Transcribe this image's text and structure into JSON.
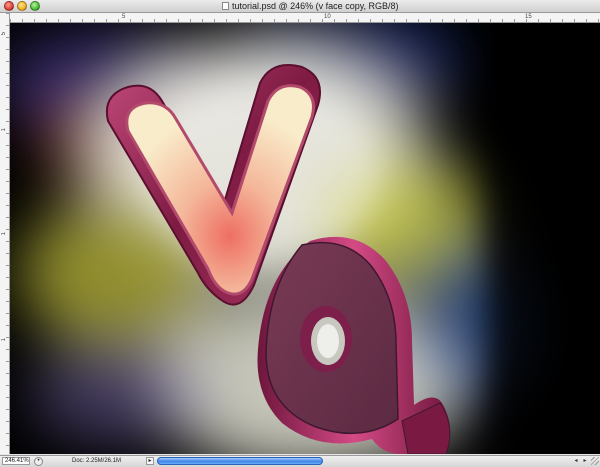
{
  "window": {
    "title": "tutorial.psd @ 246% (v face copy, RGB/8)"
  },
  "rulers": {
    "top_labels": [
      "5",
      "10",
      "15"
    ],
    "left_labels": [
      "5",
      "1",
      "1",
      "1"
    ]
  },
  "status_bar": {
    "zoom": "246.41%",
    "doc_info": "Doc: 2.25M/26.1M"
  },
  "icons": {
    "close": "close-button-icon",
    "minimize": "minimize-button-icon",
    "zoom": "zoom-button-icon",
    "document": "document-icon",
    "status_menu": "triangle-right-icon",
    "scroll_left": "arrow-left-icon",
    "scroll_right": "arrow-right-icon"
  },
  "colors": {
    "letter_magenta": "#8a1f4a",
    "letter_face_light": "#f7e7c4",
    "letter_face_glow": "#ef7a6c",
    "scroll_blue": "#3d86e8"
  }
}
